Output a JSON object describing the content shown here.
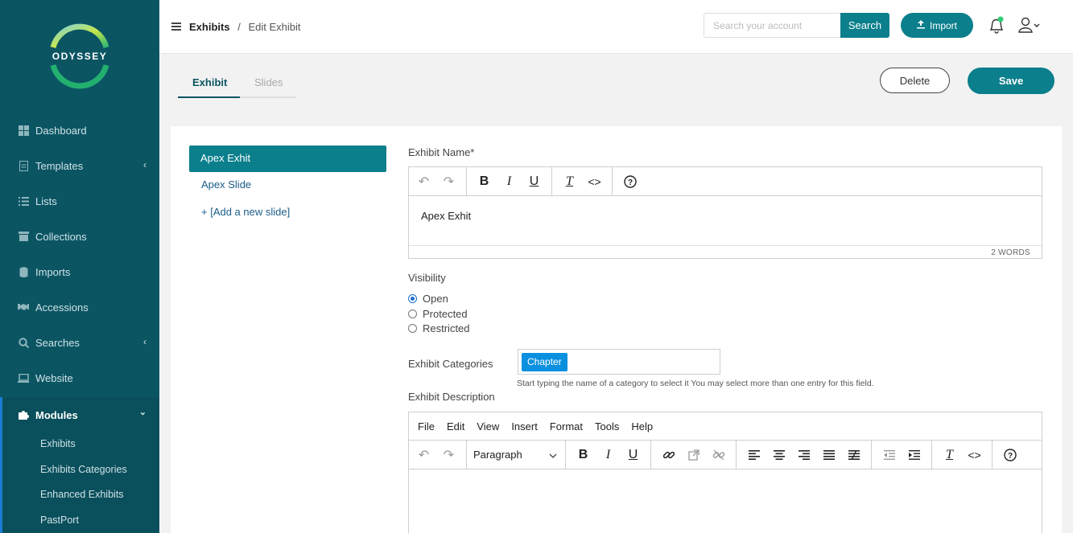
{
  "sidebar": {
    "logo_text": "ODYSSEY",
    "items": [
      {
        "label": "Dashboard"
      },
      {
        "label": "Templates"
      },
      {
        "label": "Lists"
      },
      {
        "label": "Collections"
      },
      {
        "label": "Imports"
      },
      {
        "label": "Accessions"
      },
      {
        "label": "Searches"
      },
      {
        "label": "Website"
      },
      {
        "label": "Modules"
      }
    ],
    "subitems": [
      {
        "label": "Exhibits"
      },
      {
        "label": "Exhibits Categories"
      },
      {
        "label": "Enhanced Exhibits"
      },
      {
        "label": "PastPort"
      }
    ]
  },
  "header": {
    "breadcrumb_root": "Exhibits",
    "breadcrumb_sep": "/",
    "breadcrumb_current": "Edit Exhibit",
    "search_placeholder": "Search your account",
    "search_button": "Search",
    "import_button": "Import"
  },
  "tabs": [
    {
      "label": "Exhibit"
    },
    {
      "label": "Slides"
    }
  ],
  "actions": {
    "delete": "Delete",
    "save": "Save"
  },
  "slides": {
    "active": "Apex Exhit",
    "items": [
      {
        "label": "Apex Slide"
      },
      {
        "label": "+ [Add a new slide]"
      }
    ]
  },
  "form": {
    "name_label": "Exhibit Name*",
    "name_value": "Apex Exhit",
    "word_count": "2 WORDS",
    "visibility_label": "Visibility",
    "visibility_options": [
      {
        "label": "Open",
        "selected": true
      },
      {
        "label": "Protected",
        "selected": false
      },
      {
        "label": "Restricted",
        "selected": false
      }
    ],
    "categories_label": "Exhibit Categories",
    "category_chip": "Chapter",
    "categories_hint": "Start typing the name of a category to select it You may select more than one entry for this field.",
    "description_label": "Exhibit Description",
    "menu": [
      "File",
      "Edit",
      "View",
      "Insert",
      "Format",
      "Tools",
      "Help"
    ],
    "format_select": "Paragraph"
  },
  "colors": {
    "sidebar_bg": "#0b5563",
    "accent": "#0b7f8c",
    "chip": "#0b90e0",
    "notification_dot": "#2ecc71"
  }
}
